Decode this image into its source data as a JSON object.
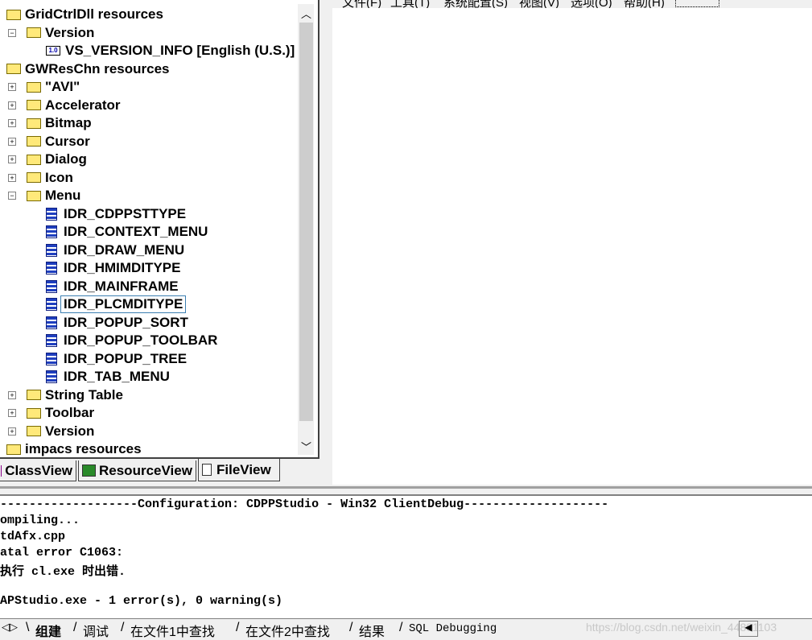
{
  "menubar": {
    "items": [
      "文件(F)",
      "工具(T)",
      "系统配置(S)",
      "视图(V)",
      "选项(O)",
      "帮助(H)"
    ]
  },
  "tree": {
    "items": [
      {
        "label": "GridCtrlDll resources",
        "level": 0,
        "icon": "open-folder-icon"
      },
      {
        "label": "Version",
        "level": 1,
        "icon": "open-folder-icon",
        "expander": "−"
      },
      {
        "label": "VS_VERSION_INFO [English (U.S.)]",
        "level": 2,
        "icon": "version-icon"
      },
      {
        "label": "GWResChn resources",
        "level": 0,
        "icon": "open-folder-icon"
      },
      {
        "label": "\"AVI\"",
        "level": 1,
        "icon": "folder-icon",
        "expander": "+"
      },
      {
        "label": "Accelerator",
        "level": 1,
        "icon": "folder-icon",
        "expander": "+"
      },
      {
        "label": "Bitmap",
        "level": 1,
        "icon": "folder-icon",
        "expander": "+"
      },
      {
        "label": "Cursor",
        "level": 1,
        "icon": "folder-icon",
        "expander": "+"
      },
      {
        "label": "Dialog",
        "level": 1,
        "icon": "folder-icon",
        "expander": "+"
      },
      {
        "label": "Icon",
        "level": 1,
        "icon": "folder-icon",
        "expander": "+"
      },
      {
        "label": "Menu",
        "level": 1,
        "icon": "open-folder-icon",
        "expander": "−"
      },
      {
        "label": "IDR_CDPPSTTYPE",
        "level": 2,
        "icon": "menu-icon"
      },
      {
        "label": "IDR_CONTEXT_MENU",
        "level": 2,
        "icon": "menu-icon"
      },
      {
        "label": "IDR_DRAW_MENU",
        "level": 2,
        "icon": "menu-icon"
      },
      {
        "label": "IDR_HMIMDITYPE",
        "level": 2,
        "icon": "menu-icon"
      },
      {
        "label": "IDR_MAINFRAME",
        "level": 2,
        "icon": "menu-icon"
      },
      {
        "label": "IDR_PLCMDITYPE",
        "level": 2,
        "icon": "menu-icon",
        "selected": true
      },
      {
        "label": "IDR_POPUP_SORT",
        "level": 2,
        "icon": "menu-icon"
      },
      {
        "label": "IDR_POPUP_TOOLBAR",
        "level": 2,
        "icon": "menu-icon"
      },
      {
        "label": "IDR_POPUP_TREE",
        "level": 2,
        "icon": "menu-icon"
      },
      {
        "label": "IDR_TAB_MENU",
        "level": 2,
        "icon": "menu-icon"
      },
      {
        "label": "String Table",
        "level": 1,
        "icon": "folder-icon",
        "expander": "+"
      },
      {
        "label": "Toolbar",
        "level": 1,
        "icon": "folder-icon",
        "expander": "+"
      },
      {
        "label": "Version",
        "level": 1,
        "icon": "folder-icon",
        "expander": "+"
      },
      {
        "label": "impacs resources",
        "level": 0,
        "icon": "folder-icon"
      }
    ]
  },
  "workspace_tabs": [
    {
      "label": "ClassView"
    },
    {
      "label": "ResourceView",
      "active": true
    },
    {
      "label": "FileView"
    }
  ],
  "output": {
    "lines": [
      "-------------------Configuration: CDPPStudio - Win32 ClientDebug--------------------",
      "ompiling...",
      "tdAfx.cpp",
      "atal error C1063:",
      "执行 cl.exe 时出错.",
      "",
      "APStudio.exe - 1 error(s), 0 warning(s)"
    ]
  },
  "output_tabs": [
    "组建",
    "调试",
    "在文件1中查找",
    "在文件2中查找",
    "结果",
    "SQL Debugging"
  ],
  "watermark": "https://blog.csdn.net/weixin_44881103"
}
